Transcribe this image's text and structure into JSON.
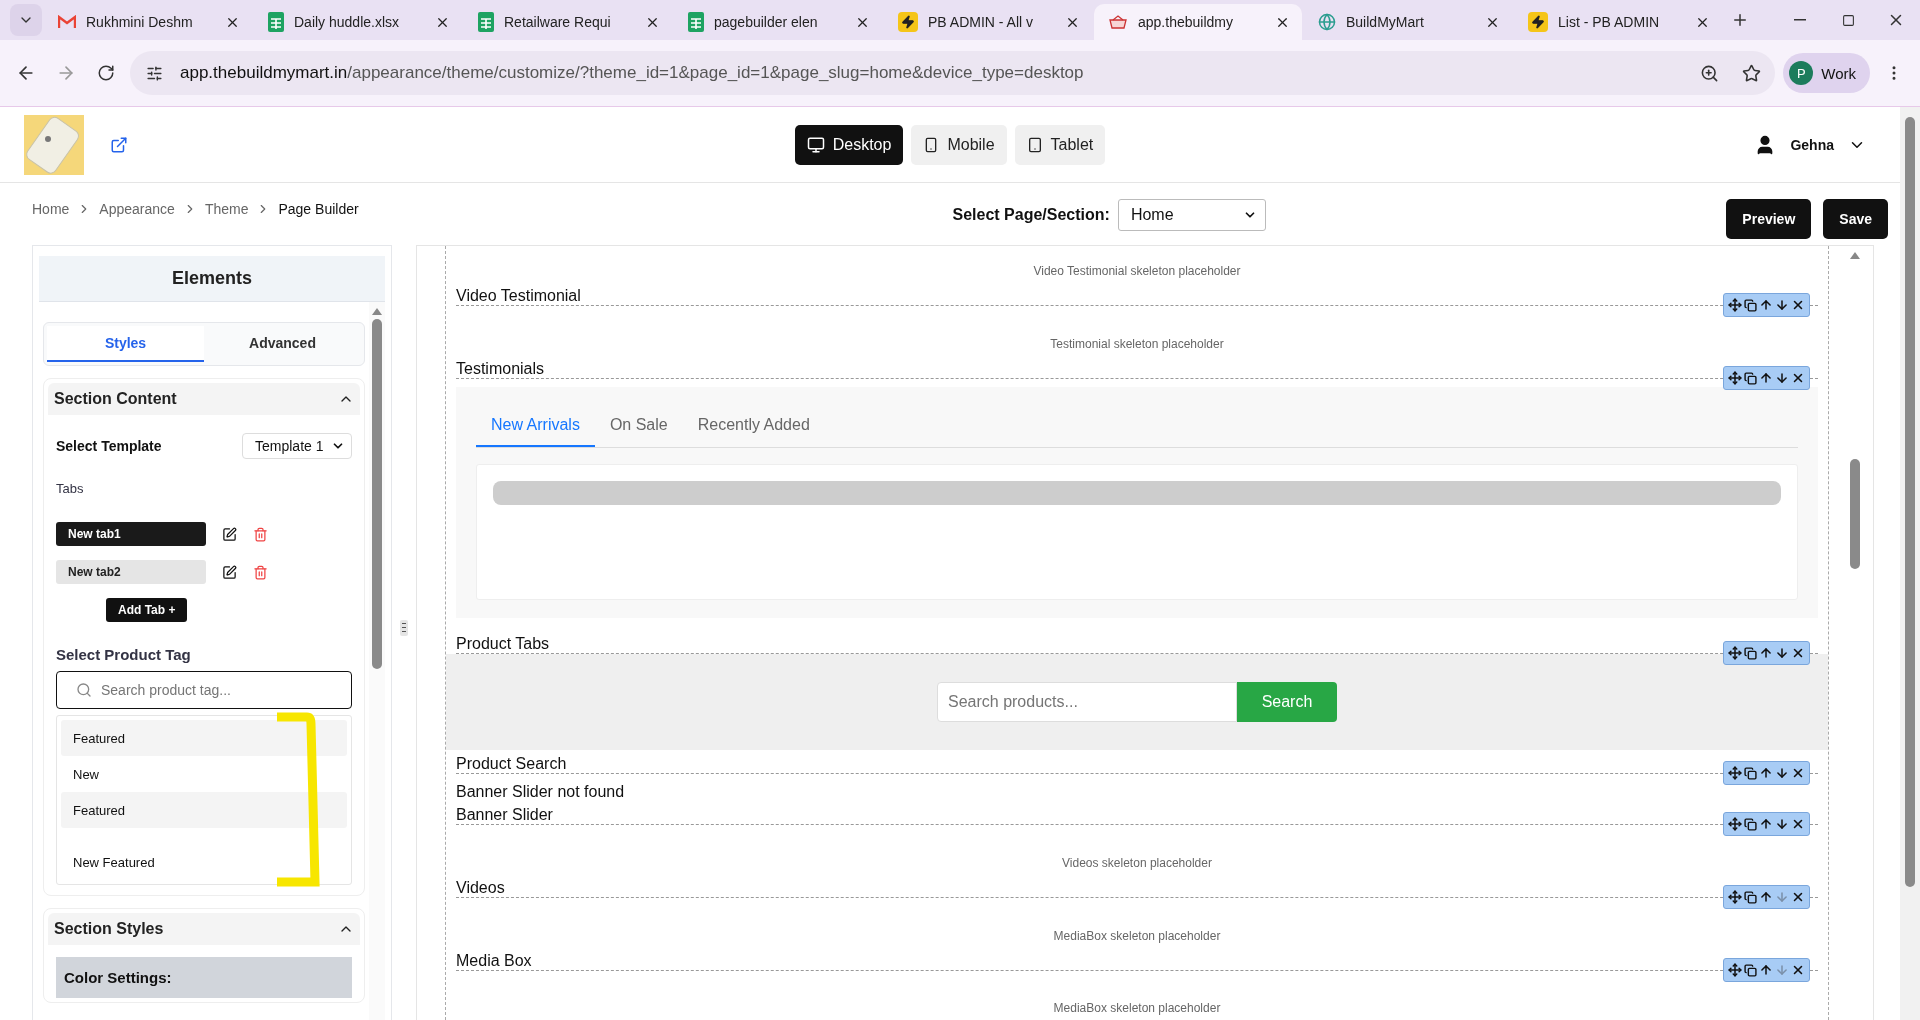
{
  "browser": {
    "tabs": [
      {
        "title": "Rukhmini Deshm",
        "kind": "gmail",
        "selected": false
      },
      {
        "title": "Daily huddle.xlsx",
        "kind": "sheets",
        "selected": false
      },
      {
        "title": "Retailware Requi",
        "kind": "sheets",
        "selected": false
      },
      {
        "title": "pagebuilder elen",
        "kind": "sheets",
        "selected": false
      },
      {
        "title": "PB ADMIN - All v",
        "kind": "bolt",
        "selected": false
      },
      {
        "title": "app.thebuildmy",
        "kind": "site",
        "selected": true
      },
      {
        "title": "BuildMyMart",
        "kind": "globe",
        "selected": false
      },
      {
        "title": "List - PB ADMIN",
        "kind": "bolt",
        "selected": false
      }
    ],
    "url_host": "app.thebuildmymart.in",
    "url_path": "/appearance/theme/customize/?theme_id=1&page_id=1&page_slug=home&device_type=desktop",
    "profile": {
      "initial": "P",
      "label": "Work"
    }
  },
  "header": {
    "devices": [
      {
        "label": "Desktop",
        "kind": "monitor",
        "selected": true
      },
      {
        "label": "Mobile",
        "kind": "phone",
        "selected": false
      },
      {
        "label": "Tablet",
        "kind": "tablet",
        "selected": false
      }
    ],
    "user": "Gehna"
  },
  "breadcrumb": [
    "Home",
    "Appearance",
    "Theme",
    "Page Builder"
  ],
  "page_select": {
    "label": "Select Page/Section:",
    "value": "Home"
  },
  "actions": [
    "Preview",
    "Save"
  ],
  "panel": {
    "title": "Elements",
    "tabs": [
      {
        "label": "Styles",
        "selected": true
      },
      {
        "label": "Advanced",
        "selected": false
      }
    ],
    "content": {
      "title": "Section Content",
      "expanded": true,
      "template_label": "Select Template",
      "template_value": "Template 1",
      "tabs_label": "Tabs",
      "tab_items": [
        {
          "label": "New tab1",
          "selected": true
        },
        {
          "label": "New tab2",
          "selected": false
        }
      ],
      "add_tab": "Add Tab +",
      "tag_label": "Select Product Tag",
      "tag_search_placeholder": "Search product tag...",
      "tag_options": [
        {
          "label": "Featured",
          "selected": true
        },
        {
          "label": "New",
          "selected": false
        },
        {
          "label": "Featured",
          "selected": true
        },
        {
          "label": "New Featured",
          "selected": false
        }
      ]
    },
    "styles": {
      "title": "Section Styles",
      "expanded": true,
      "color_heading": "Color Settings:"
    }
  },
  "canvas": {
    "sections": [
      {
        "kind": "placeholder",
        "placeholder": "Video Testimonial skeleton placeholder",
        "label": "Video Testimonial",
        "down_enabled": true
      },
      {
        "kind": "placeholder",
        "placeholder": "Testimonial skeleton placeholder",
        "label": "Testimonials",
        "down_enabled": true
      },
      {
        "kind": "tabs",
        "tabs": [
          {
            "label": "New Arrivals",
            "selected": true
          },
          {
            "label": "On Sale",
            "selected": false
          },
          {
            "label": "Recently Added",
            "selected": false
          }
        ],
        "label": "Product Tabs",
        "down_enabled": true
      },
      {
        "kind": "search",
        "search_placeholder": "Search products...",
        "button": "Search",
        "label": "Product Search",
        "down_enabled": true
      },
      {
        "kind": "message",
        "message": "Banner Slider not found",
        "label": "Banner Slider",
        "down_enabled": true
      },
      {
        "kind": "placeholder",
        "placeholder": "Videos skeleton placeholder",
        "label": "Videos",
        "down_enabled": false
      },
      {
        "kind": "placeholder",
        "placeholder": "MediaBox skeleton placeholder",
        "label": "Media Box",
        "down_enabled": false
      },
      {
        "kind": "tail",
        "placeholder": "MediaBox skeleton placeholder"
      }
    ]
  }
}
